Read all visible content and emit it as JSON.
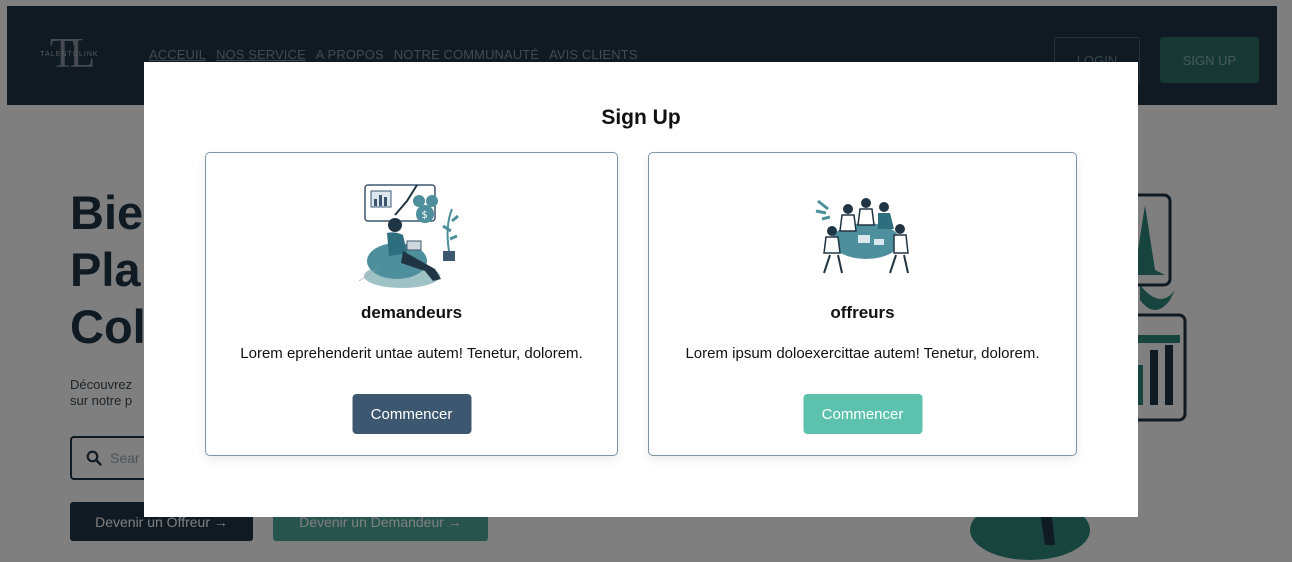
{
  "brand": {
    "word": "TALENTOLINK"
  },
  "nav": {
    "links": [
      "ACCEUIL",
      "NOS SERVICE",
      "A PROPOS",
      "NOTRE COMMUNAUTÉ",
      "AVIS CLIENTS"
    ],
    "login_label": "LOGIN",
    "signup_label": "SIGN UP"
  },
  "hero": {
    "title_lines": [
      "Bie",
      "Pla",
      "Col"
    ],
    "desc_lines": [
      "Découvrez",
      "sur notre p"
    ],
    "search_placeholder": "Sear",
    "offreur_label": "Devenir un Offreur →",
    "demandeur_label": "Devenir un Demandeur →"
  },
  "modal": {
    "title": "Sign Up",
    "cards": [
      {
        "name": "demandeurs",
        "desc": "Lorem eprehenderit untae autem! Tenetur, dolorem.",
        "cta_label": "Commencer",
        "icon": "person-on-beanbag-illustration"
      },
      {
        "name": "offreurs",
        "desc": "Lorem ipsum doloexercittae autem! Tenetur, dolorem.",
        "cta_label": "Commencer",
        "icon": "team-meeting-illustration"
      }
    ]
  },
  "colors": {
    "navbar": "#203544",
    "primary_dark": "#3d5770",
    "teal": "#5cc2ae",
    "card_border": "#7f93a6"
  }
}
